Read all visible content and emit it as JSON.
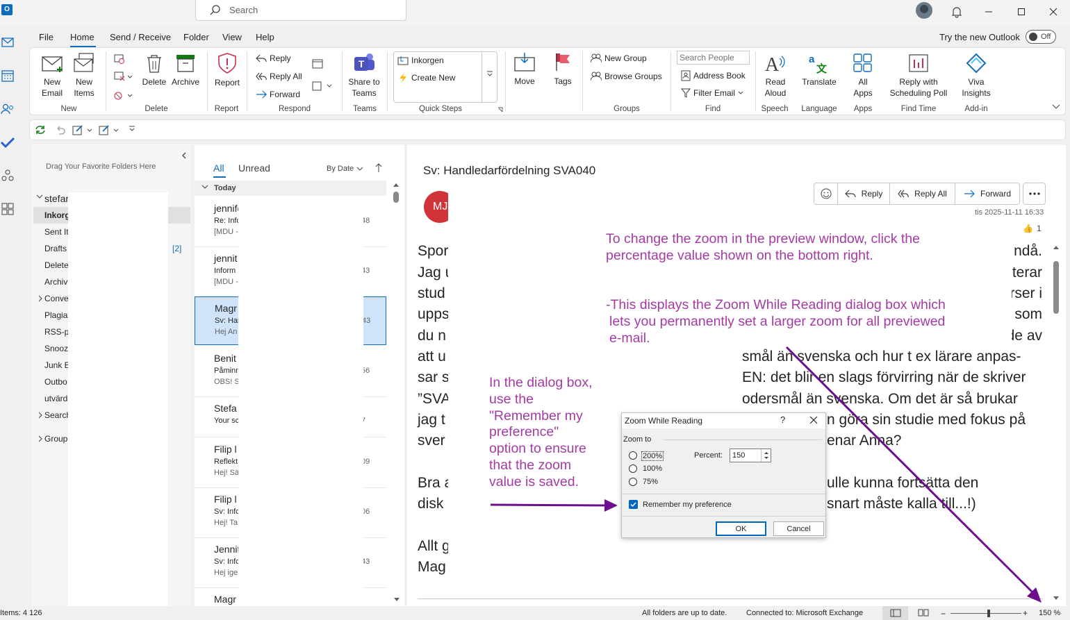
{
  "titlebar": {
    "search_placeholder": "Search"
  },
  "menu": [
    "File",
    "Home",
    "Send / Receive",
    "Folder",
    "View",
    "Help"
  ],
  "try_new": {
    "label": "Try the new Outlook",
    "toggle": "Off"
  },
  "ribbon": {
    "new_email": "New\nEmail",
    "new_items": "New\nItems",
    "delete": "Delete",
    "archive": "Archive",
    "report": "Report",
    "reply": "Reply",
    "reply_all": "Reply All",
    "forward": "Forward",
    "share_teams": "Share to\nTeams",
    "qs_inbox": "Inkorgen",
    "qs_create": "Create New",
    "move": "Move",
    "tags": "Tags",
    "new_group": "New Group",
    "browse_groups": "Browse Groups",
    "search_people": "Search People",
    "address_book": "Address Book",
    "filter_email": "Filter Email",
    "read_aloud": "Read\nAloud",
    "translate": "Translate",
    "all_apps": "All\nApps",
    "reply_poll": "Reply with\nScheduling Poll",
    "viva": "Viva\nInsights",
    "groups": [
      "New",
      "Delete",
      "Report",
      "Respond",
      "Teams",
      "Quick Steps",
      "Groups",
      "Find",
      "Speech",
      "Language",
      "Apps",
      "Find Time",
      "Add-in"
    ]
  },
  "folders": {
    "favorites_hint": "Drag Your Favorite Folders Here",
    "account": "stefar",
    "items": [
      "Inkorg",
      "Sent It",
      "Drafts",
      "Delete",
      "Archiv",
      "Conve",
      "Plagiat",
      "RSS-pr",
      "Snooz",
      "Junk E",
      "Outbo",
      "utvärd",
      "Search",
      "Group"
    ],
    "drafts_count": "[2]"
  },
  "list": {
    "tab_all": "All",
    "tab_unread": "Unread",
    "sort": "By Date",
    "today": "Today",
    "mails": [
      {
        "sender": "jennifer",
        "subject": "Re: Infc",
        "preview": "[MDU -",
        "num": "48"
      },
      {
        "sender": "jennit",
        "subject": "Inform",
        "preview": "[MDU -",
        "num": "43"
      },
      {
        "sender": "Magr",
        "subject": "Sv: Har",
        "preview": "Hej An",
        "num": "43"
      },
      {
        "sender": "Benit",
        "subject": "Påminn",
        "preview": "OBS! S",
        "num": "56"
      },
      {
        "sender": "Stefa",
        "subject": "Your sc",
        "preview": "",
        "num": "7"
      },
      {
        "sender": "Filip l",
        "subject": "Reflekt",
        "preview": "Hej! Sä",
        "num": "09"
      },
      {
        "sender": "Filip l",
        "subject": "Sv: Infc",
        "preview": "Hej! Ta",
        "num": "06"
      },
      {
        "sender": "Jennit",
        "subject": "Sv: Infc",
        "preview": "Hej ige",
        "num": "43"
      },
      {
        "sender": "Magr",
        "subject": "",
        "preview": "",
        "num": ""
      }
    ]
  },
  "reading": {
    "subject": "Sv: Handledarfördelning SVA040",
    "avatar": "MJ",
    "reply": "Reply",
    "reply_all": "Reply All",
    "forward": "Forward",
    "date": "tis 2025-11-11 16:33",
    "likes": "1",
    "left_lines": [
      "Spor",
      "Jag u",
      "stud",
      "upps",
      "du n",
      "att u",
      "sar s",
      "”SVA",
      "jag t",
      "sver",
      "",
      "Bra a",
      "disk",
      "",
      "Allt g",
      "Mag"
    ],
    "right_lines": [
      "ndå.",
      "terar",
      "rser i",
      "som",
      "de av"
    ],
    "mid_lines": [
      "smål än svenska och hur t ex lärare anpas-",
      "EN: det blir en slags förvirring när de skriver",
      "odersmål än svenska. Om det är så brukar",
      "n göra sin studie med fokus på",
      "enar Anna?",
      "",
      "ulle kunna fortsätta den",
      "snart måste kalla till...!)"
    ]
  },
  "annotations": {
    "top": "To change the zoom in the preview window, click the percentage value shown on the bottom right.",
    "mid1": "-This displays the Zoom While Reading dialog box which",
    "mid2": "lets you permanently set a larger zoom for all previewed",
    "mid3": "e-mail.",
    "left": [
      "In the dialog box,",
      "use the",
      "\"Remember my",
      "preference\"",
      "option to ensure",
      "that the zoom",
      "value is saved."
    ],
    "color": "#a43ba5",
    "arrow_color": "#6b0f8e"
  },
  "dialog": {
    "title": "Zoom While Reading",
    "help": "?",
    "zoom_to": "Zoom to",
    "opt200": "200%",
    "opt100": "100%",
    "opt75": "75%",
    "percent_label": "Percent:",
    "percent_value": "150",
    "remember": "Remember my preference",
    "ok": "OK",
    "cancel": "Cancel"
  },
  "status": {
    "items": "Items: 4 126",
    "sync": "All folders are up to date.",
    "connected": "Connected to: Microsoft Exchange",
    "zoom": "150 %"
  }
}
